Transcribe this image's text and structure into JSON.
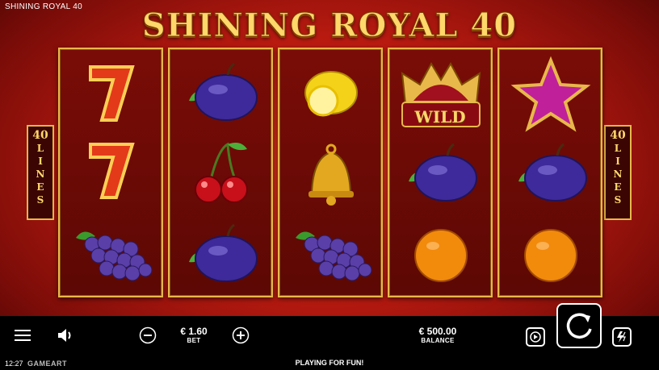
{
  "window_title": "SHINING  ROYAL 40",
  "logo_text": "SHINING ROYAL 40",
  "side_panel": {
    "number": "40",
    "word": [
      "L",
      "I",
      "N",
      "E",
      "S"
    ]
  },
  "reels": [
    [
      "seven",
      "seven",
      "grapes"
    ],
    [
      "plum",
      "cherries",
      "plum"
    ],
    [
      "lemon",
      "bell",
      "grapes"
    ],
    [
      "wild-crown",
      "plum",
      "orange"
    ],
    [
      "star",
      "plum",
      "orange"
    ]
  ],
  "wild_label": "WILD",
  "bet": {
    "value": "€ 1.60",
    "label": "BET"
  },
  "balance": {
    "value": "€ 500.00",
    "label": "BALANCE"
  },
  "status_text": "PLAYING FOR FUN!",
  "clock": "12:27",
  "brand": "GAMEART",
  "icons": [
    "menu-icon",
    "sound-icon",
    "minus-icon",
    "plus-icon",
    "autoplay-icon",
    "spin-icon",
    "turbo-icon"
  ],
  "colors": {
    "frame_gold": "#e8b84a",
    "bg_red": "#c21e12"
  }
}
